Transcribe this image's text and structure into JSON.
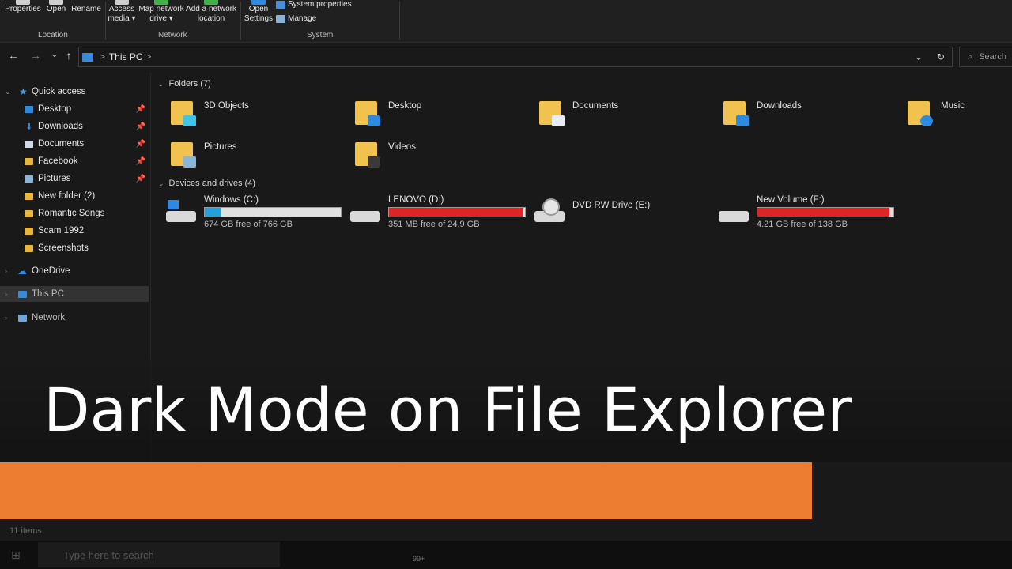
{
  "ribbon": {
    "location": {
      "group_label": "Location",
      "buttons": [
        {
          "label": "Properties"
        },
        {
          "label": "Open"
        },
        {
          "label": "Rename"
        }
      ]
    },
    "network": {
      "group_label": "Network",
      "buttons": [
        {
          "label_line1": "Access",
          "label_line2": "media ▾"
        },
        {
          "label_line1": "Map network",
          "label_line2": "drive ▾"
        },
        {
          "label_line1": "Add a network",
          "label_line2": "location"
        }
      ]
    },
    "system": {
      "group_label": "System",
      "open_settings_line1": "Open",
      "open_settings_line2": "Settings",
      "system_properties": "System properties",
      "manage": "Manage"
    }
  },
  "address_bar": {
    "location": "This PC",
    "search_placeholder": "Search"
  },
  "sidebar": {
    "quick_access": "Quick access",
    "quick_items": [
      {
        "label": "Desktop",
        "pinned": true
      },
      {
        "label": "Downloads",
        "pinned": true
      },
      {
        "label": "Documents",
        "pinned": true
      },
      {
        "label": "Facebook",
        "pinned": true
      },
      {
        "label": "Pictures",
        "pinned": true
      },
      {
        "label": "New folder (2)",
        "pinned": false
      },
      {
        "label": "Romantic Songs",
        "pinned": false
      },
      {
        "label": "Scam 1992",
        "pinned": false
      },
      {
        "label": "Screenshots",
        "pinned": false
      }
    ],
    "onedrive": "OneDrive",
    "this_pc": "This PC",
    "network": "Network"
  },
  "main": {
    "folders_header": "Folders (7)",
    "folders": [
      {
        "name": "3D Objects"
      },
      {
        "name": "Desktop"
      },
      {
        "name": "Documents"
      },
      {
        "name": "Downloads"
      },
      {
        "name": "Music"
      },
      {
        "name": "Pictures"
      },
      {
        "name": "Videos"
      }
    ],
    "drives_header": "Devices and drives (4)",
    "drives": [
      {
        "name": "Windows (C:)",
        "free": "674 GB free of 766 GB",
        "used_fraction": 0.12,
        "color": "#26a0da"
      },
      {
        "name": "LENOVO (D:)",
        "free": "351 MB free of 24.9 GB",
        "used_fraction": 0.986,
        "color": "#da2626"
      },
      {
        "name": "DVD RW Drive (E:)"
      },
      {
        "name": "New Volume (F:)",
        "free": "4.21 GB free of 138 GB",
        "used_fraction": 0.97,
        "color": "#da2626"
      }
    ]
  },
  "status_bar": {
    "items_count": "11 items"
  },
  "taskbar": {
    "search_placeholder": "Type here to search",
    "badge": "99+"
  },
  "overlay": {
    "title": "Dark Mode on File Explorer"
  },
  "colors": {
    "accent_orange": "#ed7d31",
    "background": "#191919"
  }
}
